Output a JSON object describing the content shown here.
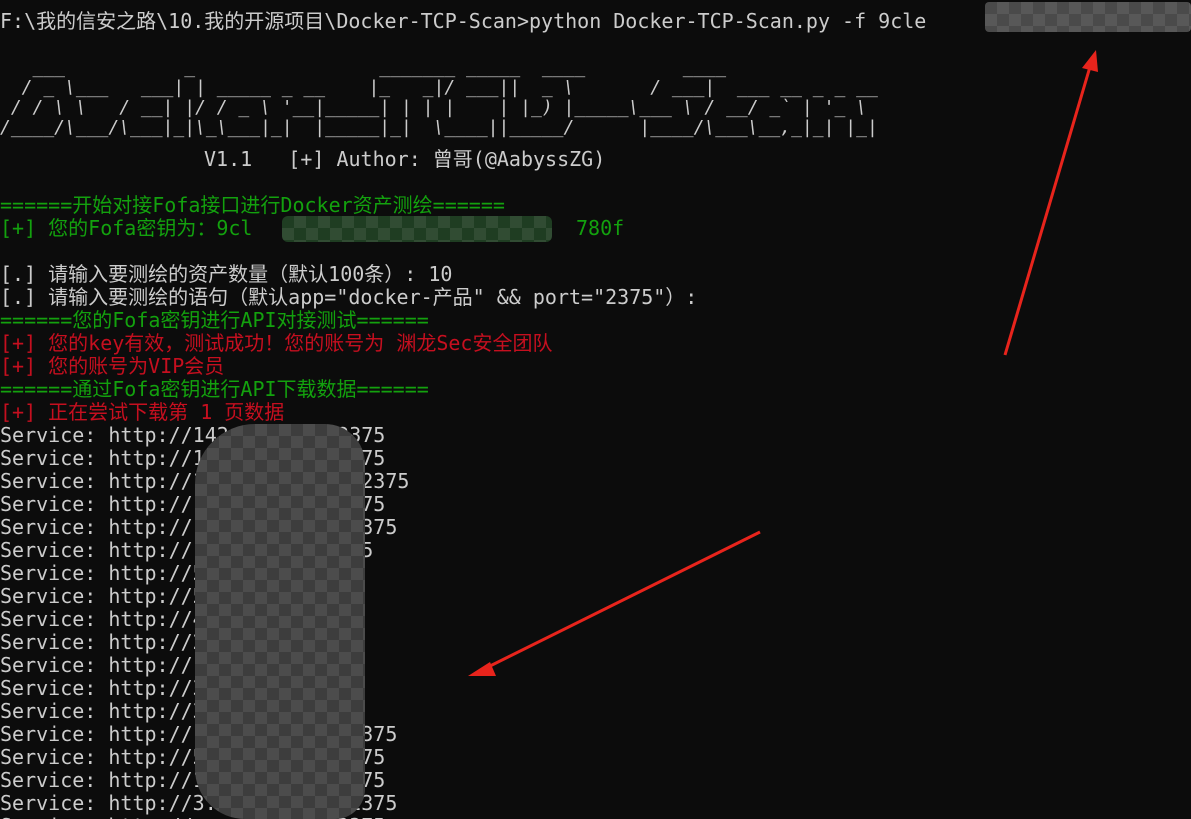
{
  "terminal": {
    "command_line": "F:\\我的信安之路\\10.我的开源项目\\Docker-TCP-Scan>python Docker-TCP-Scan.py -f 9cle",
    "banner_ascii": [
      "   ___           _                 _______ _____  ____         ____",
      "  / _ \\___   ___| | _____ _ __    |_   _|/ ___||  _ \\       / ___|  ___ __ _ _ __",
      " / / \\ \\   / __| |/ / _ \\ '__|_____| | | |    | |_) |_____\\___ \\ / __/ _` | '_ \\",
      "/____/\\___/\\___|_|\\_\\___|_|  |_____|_|  \\____||_____/      |____/\\___\\__,_|_| |_|"
    ],
    "version_line": "V1.1   [+] Author: 曾哥(@AabyssZG)",
    "fofa_start_line": "======开始对接Fofa接口进行Docker资产测绘======",
    "fofa_key_line": "[+] 您的Fofa密钥为：9cl",
    "fofa_key_tail": "780f",
    "count_prompt_line": "[.] 请输入要测绘的资产数量（默认100条）: 10",
    "query_prompt_line": "[.] 请输入要测绘的语句（默认app=\"docker-产品\" && port=\"2375\"）:",
    "api_test_line": "======您的Fofa密钥进行API对接测试======",
    "key_valid_line": "[+] 您的key有效，测试成功！您的账号为 渊龙Sec安全团队",
    "vip_line": "[+] 您的账号为VIP会员",
    "download_header_line": "======通过Fofa密钥进行API下载数据======",
    "download_page_line": "[+] 正在尝试下载第 1 页数据",
    "services": [
      "Service: http://142.     .4:2375",
      "Service: http://142.     .4:2375",
      "Service: http://159.     .159:2375",
      "Service: http://15.      54:2375",
      "Service: http://13.      110:2375",
      "Service: http://13.      0:2375",
      "Service: http://52.      2375",
      "Service: http://52.      2375",
      "Service: http://4.       2375",
      "Service: http://20.      :2375",
      "Service: http://1.       :2375",
      "Service: http://3.       :2375",
      "Service: http://3.       :2375",
      "Service: http://         226:2375",
      "Service: http://5.       32:2375",
      "Service: http://13.      09:2375",
      "Service: http://3.2      .54:2375",
      "Service: http://         52:2375"
    ]
  },
  "colors": {
    "background": "#0c0c0c",
    "text": "#cccccc",
    "green": "#13a10e",
    "red": "#c50f1f",
    "arrow": "#e8241c"
  }
}
